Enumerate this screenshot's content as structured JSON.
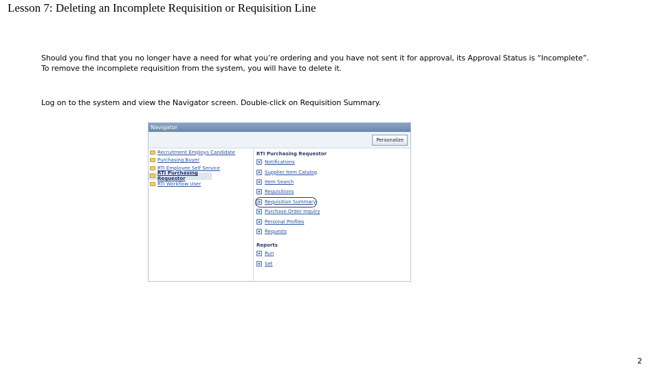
{
  "slide": {
    "title": "Lesson 7:  Deleting an Incomplete Requisition or Requisition Line",
    "paragraph1_line1": "Should you find that you no longer have a need for what you’re ordering and you have not sent it for approval, its Approval Status is “Incomplete”.",
    "paragraph1_line2": "To remove the incomplete requisition from the system, you will have to delete it.",
    "paragraph2": "Log on to the system and view the Navigator screen.  Double-click on Requisition Summary.",
    "page_number": "2"
  },
  "navigator": {
    "header": "Navigator",
    "personalize_label": "Personalize",
    "responsibilities": [
      "Recruitment Employs Candidate",
      "Purchasing Buyer",
      "RTI Employee Self Service",
      "RTI Purchasing Requestor",
      "RTI Workflow User"
    ],
    "selected_responsibility_index": 3,
    "section_title": "RTI Purchasing Requestor",
    "functions": [
      "Notifications",
      "Supplier Item Catalog",
      "Item Search",
      "Requisitions",
      "Requisition Summary",
      "Purchase Order Inquiry",
      "Personal Profiles",
      "Requests"
    ],
    "highlighted_function_index": 4,
    "reports_title": "Reports",
    "reports": [
      "Run",
      "Set"
    ]
  },
  "colors": {
    "header_blue": "#6c88ad",
    "link_blue": "#2a4f9e",
    "folder_yellow": "#f1cf6a"
  }
}
